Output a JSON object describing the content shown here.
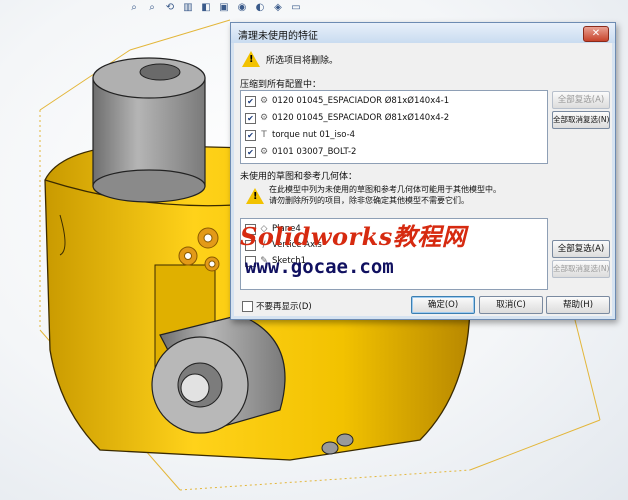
{
  "toolbar": {
    "icons": [
      "zoom-fit-icon",
      "zoom-area-icon",
      "previous-view-icon",
      "section-view-icon",
      "view-orientation-icon",
      "display-style-icon",
      "hide-show-icon",
      "appearance-icon",
      "scene-icon",
      "display-settings-icon"
    ]
  },
  "dialog": {
    "title": "清理未使用的特征",
    "close_label": "✕",
    "warning_text": "所选项目将删除。",
    "section1_label": "压缩到所有配置中：",
    "section1_items": [
      {
        "label": "0120 01045_ESPACIADOR Ø81xØ140x4-1",
        "checked": true
      },
      {
        "label": "0120 01045_ESPACIADOR Ø81xØ140x4-2",
        "checked": true
      },
      {
        "label": "torque nut 01_iso-4",
        "checked": true
      },
      {
        "label": "0101 03007_BOLT-2",
        "checked": true
      }
    ],
    "select_all_1": "全部复选(A)",
    "clear_all_1": "全部取消复选(N)",
    "section2_label": "未使用的草图和参考几何体：",
    "section2_warning_line1": "在此模型中列为未使用的草图和参考几何体可能用于其他模型中。",
    "section2_warning_line2": "请勿删除所列的项目，除非您确定其他模型不需要它们。",
    "section2_items": [
      {
        "label": "Plane4",
        "checked": false
      },
      {
        "label": "Vertice Axis",
        "checked": false
      },
      {
        "label": "Sketch1",
        "checked": false
      }
    ],
    "select_all_2": "全部复选(A)",
    "clear_all_2": "全部取消复选(N)",
    "dont_show_again": "不要再显示(D)",
    "ok": "确定(O)",
    "cancel": "取消(C)",
    "help": "帮助(H)"
  },
  "watermark": {
    "line1": "Solidworks教程网",
    "line2": "www.gocae.com"
  },
  "colors": {
    "part_yellow": "#f2c200",
    "part_gray": "#8a8a8a",
    "watermark_red": "#d62a10",
    "watermark_navy": "#101060"
  }
}
